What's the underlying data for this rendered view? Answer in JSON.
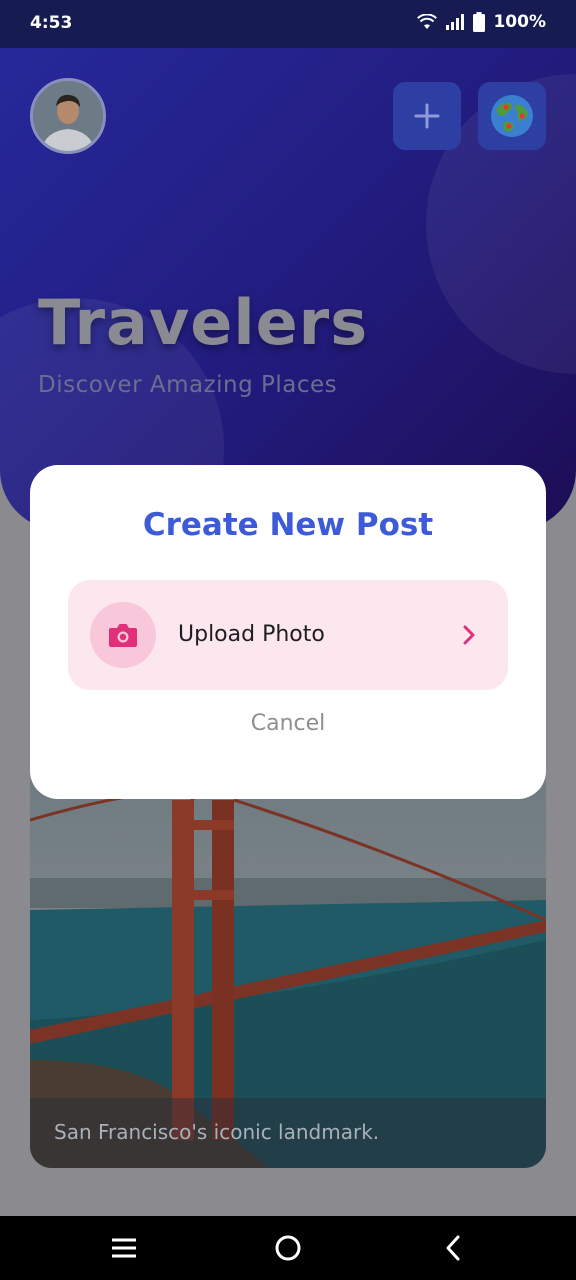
{
  "status": {
    "time": "4:53",
    "battery": "100%"
  },
  "header": {
    "title": "Travelers",
    "subtitle": "Discover Amazing Places",
    "add_icon": "plus-icon",
    "globe_icon": "globe-icon"
  },
  "dialog": {
    "title": "Create New Post",
    "upload_label": "Upload Photo",
    "cancel_label": "Cancel",
    "accent": "#3d5bd9",
    "upload_accent": "#e0307a"
  },
  "card": {
    "caption": "San Francisco's iconic landmark."
  },
  "nav": {
    "menu_icon": "menu-icon",
    "home_icon": "home-circle-icon",
    "back_icon": "back-chevron-icon"
  }
}
